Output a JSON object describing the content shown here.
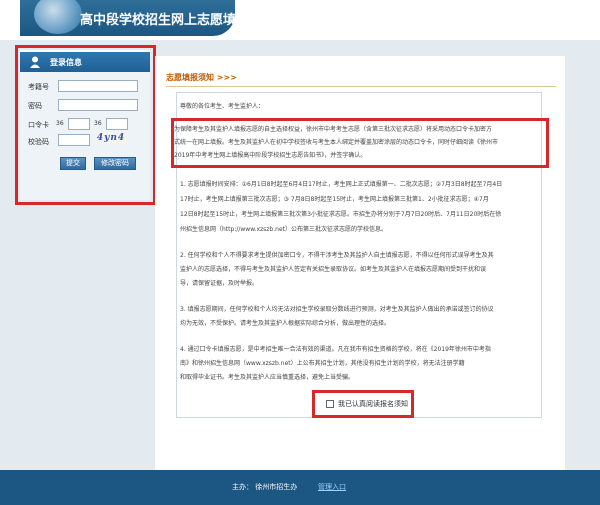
{
  "header": {
    "title": "高中段学校招生网上志愿填报系统"
  },
  "login": {
    "heading": "登录信息",
    "exam_no_label": "考籍号",
    "password_label": "密码",
    "card_label": "口令卡",
    "card_row1": "36",
    "card_row2": "36",
    "captcha_label": "校验码",
    "captcha_text": "4yn4",
    "submit": "提交",
    "change_pwd": "修改密码"
  },
  "notice": {
    "title": "志愿填报须知 >>>",
    "greeting": "尊敬的各位考生、考生监护人：",
    "p1": [
      "为保障考生及其监护人填报志愿的自主选择权益，徐州市中考考生志愿（含第三批次征求志愿）将采用动态口令卡加密方",
      "式统一在网上填报。考生及其监护人在初中学校签收与考生本人绑定并覆盖加密涂层的动态口令卡，同时仔细阅读《徐州市",
      "2019年中考考生网上填报高中阶段学校招生志愿告知书》，并签字确认。"
    ],
    "p2": [
      "1. 志愿填报时间安排：①6月1日8时起至6月4日17时止，考生网上正式填报第一、二批次志愿；②7月3日8时起至7月4日",
      "17时止，考生网上填报第三批次志愿；③ 7月8日8时起至15时止，考生网上填报第三批第1、2小批征求志愿；④7月",
      "12日8时起至15时止，考生网上填报第三批次第3小批征求志愿。市招生办将分别于7月7日20时后、7月11日20时后在徐",
      "州招生信息网（http://www.xzszb.net）公布第三批次征求志愿的学校信息。"
    ],
    "p3": [
      "2. 任何学校和个人不得要求考生提供加密口令，不得干涉考生及其监护人自主填报志愿，不得以任何形式误导考生及其",
      "监护人的志愿选择，不得与考生及其监护人签定有关招生录取协议。如考生及其监护人在填报志愿期间受到干扰和误",
      "导，请保留证据，及时举报。"
    ],
    "p4": [
      "3. 填报志愿期间，任何学校和个人均无法对招生学校录取分数线进行预测，对考生及其监护人做出的承诺或签订的协议",
      "均为无效，不受保护。请考生及其监护人根据实际综合分析，做出理性的选择。"
    ],
    "p5": [
      "4. 通过口令卡填报志愿，是中考招生唯一合法有效的渠道。凡在我市有招生资格的学校，将在《2019年徐州市中考指",
      "南》和徐州招生信息网（www.xzszb.net）上公布其招生计划，其他没有招生计划的学校，将无法注册学籍",
      "和取得毕业证书。考生及其监护人应当慎重选择，避免上当受骗。"
    ],
    "agree": "我已认真阅读报名须知"
  },
  "footer": {
    "host": "主办：  徐州市招生办",
    "admin_link": "管理入口"
  },
  "colors": {
    "brand": "#1c5683",
    "highlight": "#d62828",
    "accent": "#c05a00"
  }
}
